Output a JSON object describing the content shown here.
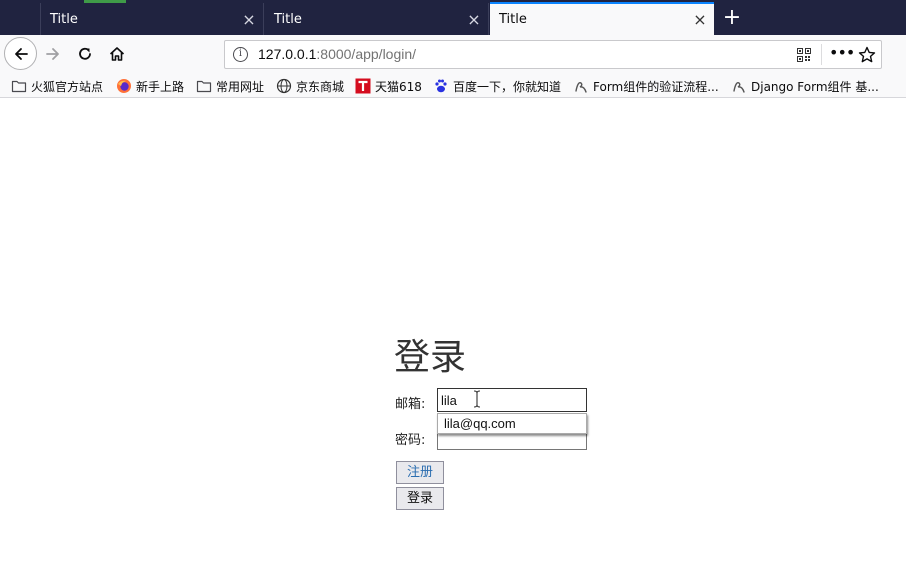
{
  "browser": {
    "tabs": [
      {
        "label": "Title",
        "active": false
      },
      {
        "label": "Title",
        "active": false
      },
      {
        "label": "Title",
        "active": true
      }
    ],
    "tab_close_glyph": "×",
    "new_tab_glyph": "+",
    "url_host": "127.0.0.1",
    "url_path": ":8000/app/login/",
    "bookmarks": [
      {
        "label": "火狐官方站点",
        "icon": "folder-icon"
      },
      {
        "label": "新手上路",
        "icon": "firefox-icon"
      },
      {
        "label": "常用网址",
        "icon": "folder-icon"
      },
      {
        "label": "京东商城",
        "icon": "globe-icon"
      },
      {
        "label": "天猫618",
        "icon": "tmall-icon"
      },
      {
        "label": "百度一下，你就知道",
        "icon": "baidu-paw-icon"
      },
      {
        "label": "Form组件的验证流程...",
        "icon": "blog-icon"
      },
      {
        "label": "Django Form组件 基...",
        "icon": "blog-icon"
      }
    ],
    "colors": {
      "tabbar": "#202340",
      "active_tab_accent": "#0a84ff"
    }
  },
  "page": {
    "title": "登录",
    "email_label": "邮箱:",
    "email_value": "lila",
    "autocomplete_option": "lila@qq.com",
    "password_label": "密码:",
    "register_button": "注册",
    "login_button": "登录"
  }
}
